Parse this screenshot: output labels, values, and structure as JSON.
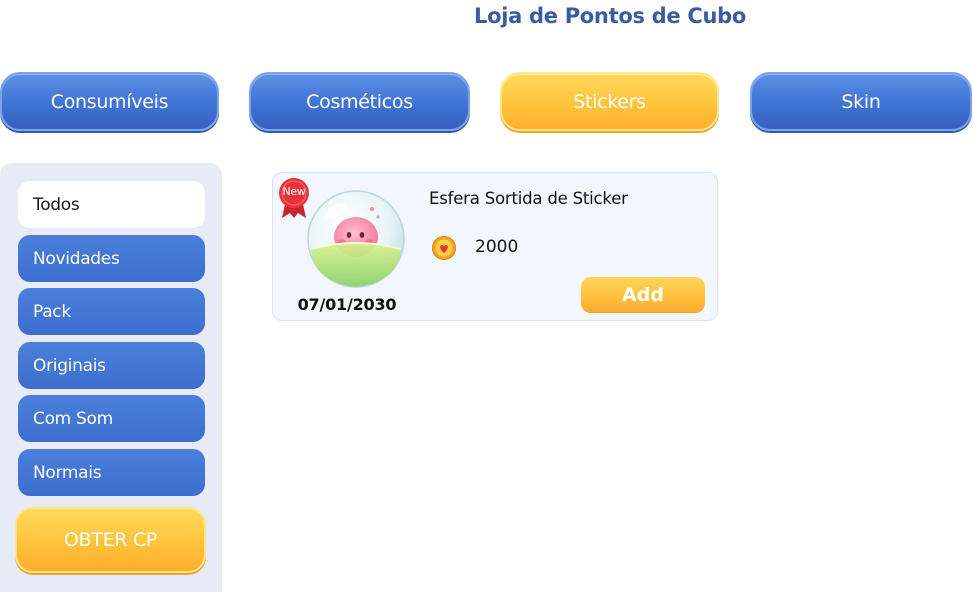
{
  "page_title": "Loja de Pontos de Cubo",
  "tabs": [
    {
      "label": "Consumíveis",
      "active": false
    },
    {
      "label": "Cosméticos",
      "active": false
    },
    {
      "label": "Stickers",
      "active": true
    },
    {
      "label": "Skin",
      "active": false
    }
  ],
  "sidebar": {
    "items": [
      {
        "label": "Todos",
        "active": true
      },
      {
        "label": "Novidades",
        "active": false
      },
      {
        "label": "Pack",
        "active": false
      },
      {
        "label": "Originais",
        "active": false
      },
      {
        "label": "Com Som",
        "active": false
      },
      {
        "label": "Normais",
        "active": false
      }
    ],
    "cp_button_label": "OBTER CP"
  },
  "products": [
    {
      "badge": "New",
      "name": "Esfera Sortida de Sticker",
      "price": "2000",
      "currency_icon": "cube-coin-icon",
      "date": "07/01/2030",
      "add_label": "Add"
    }
  ],
  "colors": {
    "title": "#3b5ba3",
    "tab_blue": "#3f73d3",
    "tab_active_yellow": "#ffc23a",
    "sidebar_bg": "#e6ebf5",
    "badge_red": "#e8333c"
  }
}
